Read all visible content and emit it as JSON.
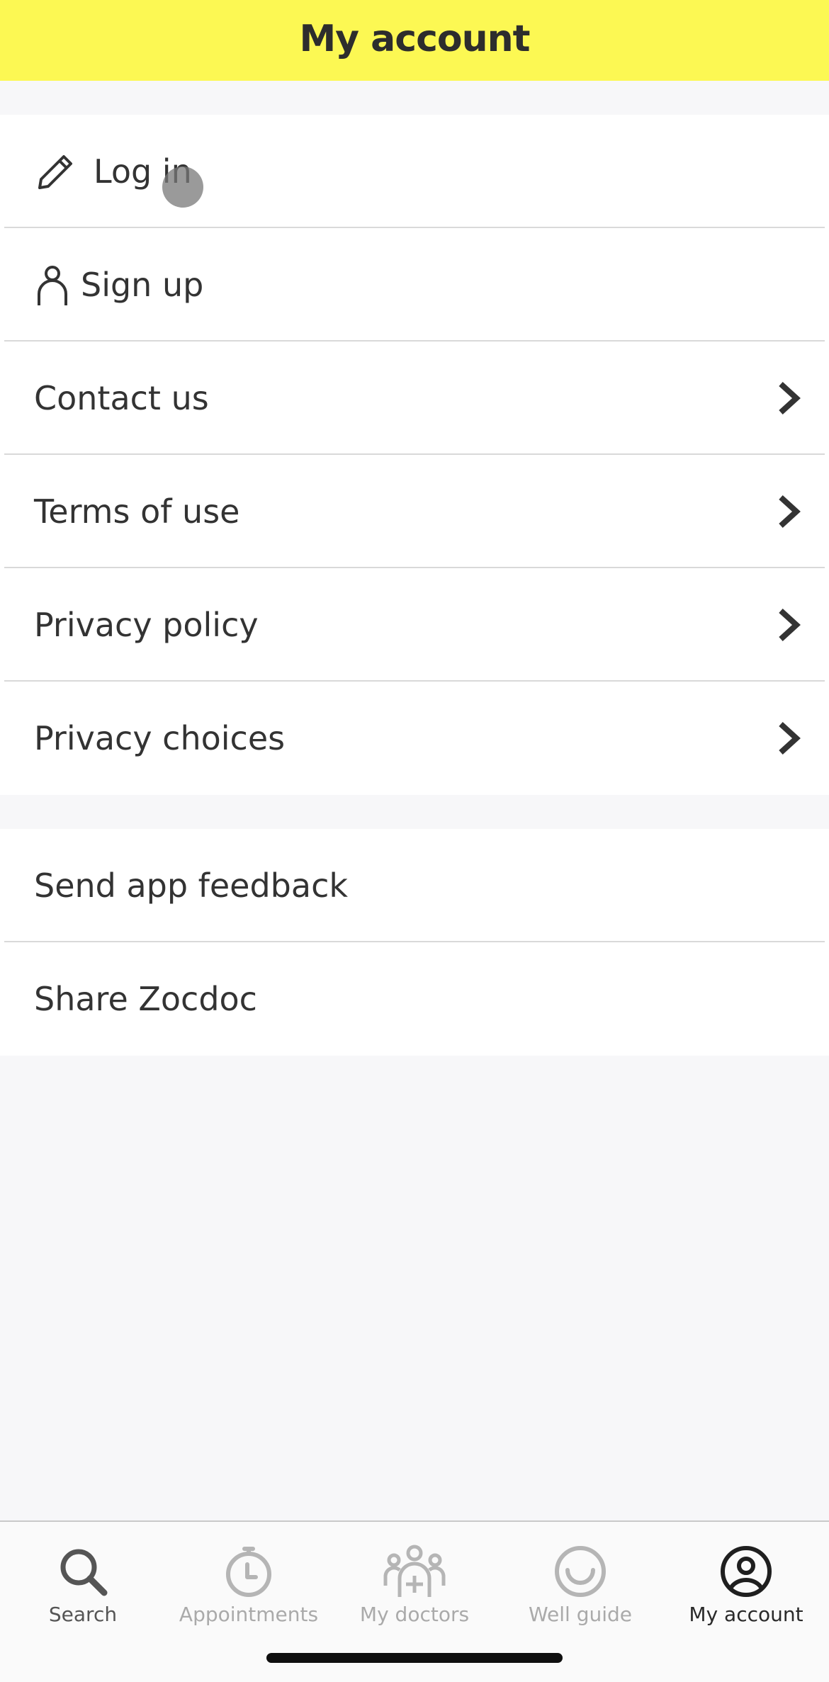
{
  "header": {
    "title": "My account"
  },
  "account_menu": {
    "items": [
      {
        "label": "Log in",
        "icon": "pencil-icon"
      },
      {
        "label": "Sign up",
        "icon": "user-icon"
      },
      {
        "label": "Contact us",
        "icon": "chevron-right-icon"
      },
      {
        "label": "Terms of use",
        "icon": "chevron-right-icon"
      },
      {
        "label": "Privacy policy",
        "icon": "chevron-right-icon"
      },
      {
        "label": "Privacy choices",
        "icon": "chevron-right-icon"
      }
    ]
  },
  "app_menu": {
    "items": [
      {
        "label": "Send app feedback"
      },
      {
        "label": "Share Zocdoc"
      }
    ]
  },
  "tabbar": {
    "tabs": [
      {
        "label": "Search",
        "icon": "search-icon"
      },
      {
        "label": "Appointments",
        "icon": "clock-icon"
      },
      {
        "label": "My doctors",
        "icon": "doctors-icon"
      },
      {
        "label": "Well guide",
        "icon": "smile-icon"
      },
      {
        "label": "My account",
        "icon": "account-circle-icon",
        "selected": true
      }
    ]
  },
  "colors": {
    "header_bg": "#fcf853",
    "active_tab": "#2a2a2a",
    "inactive_tab": "#aaaaaa"
  }
}
